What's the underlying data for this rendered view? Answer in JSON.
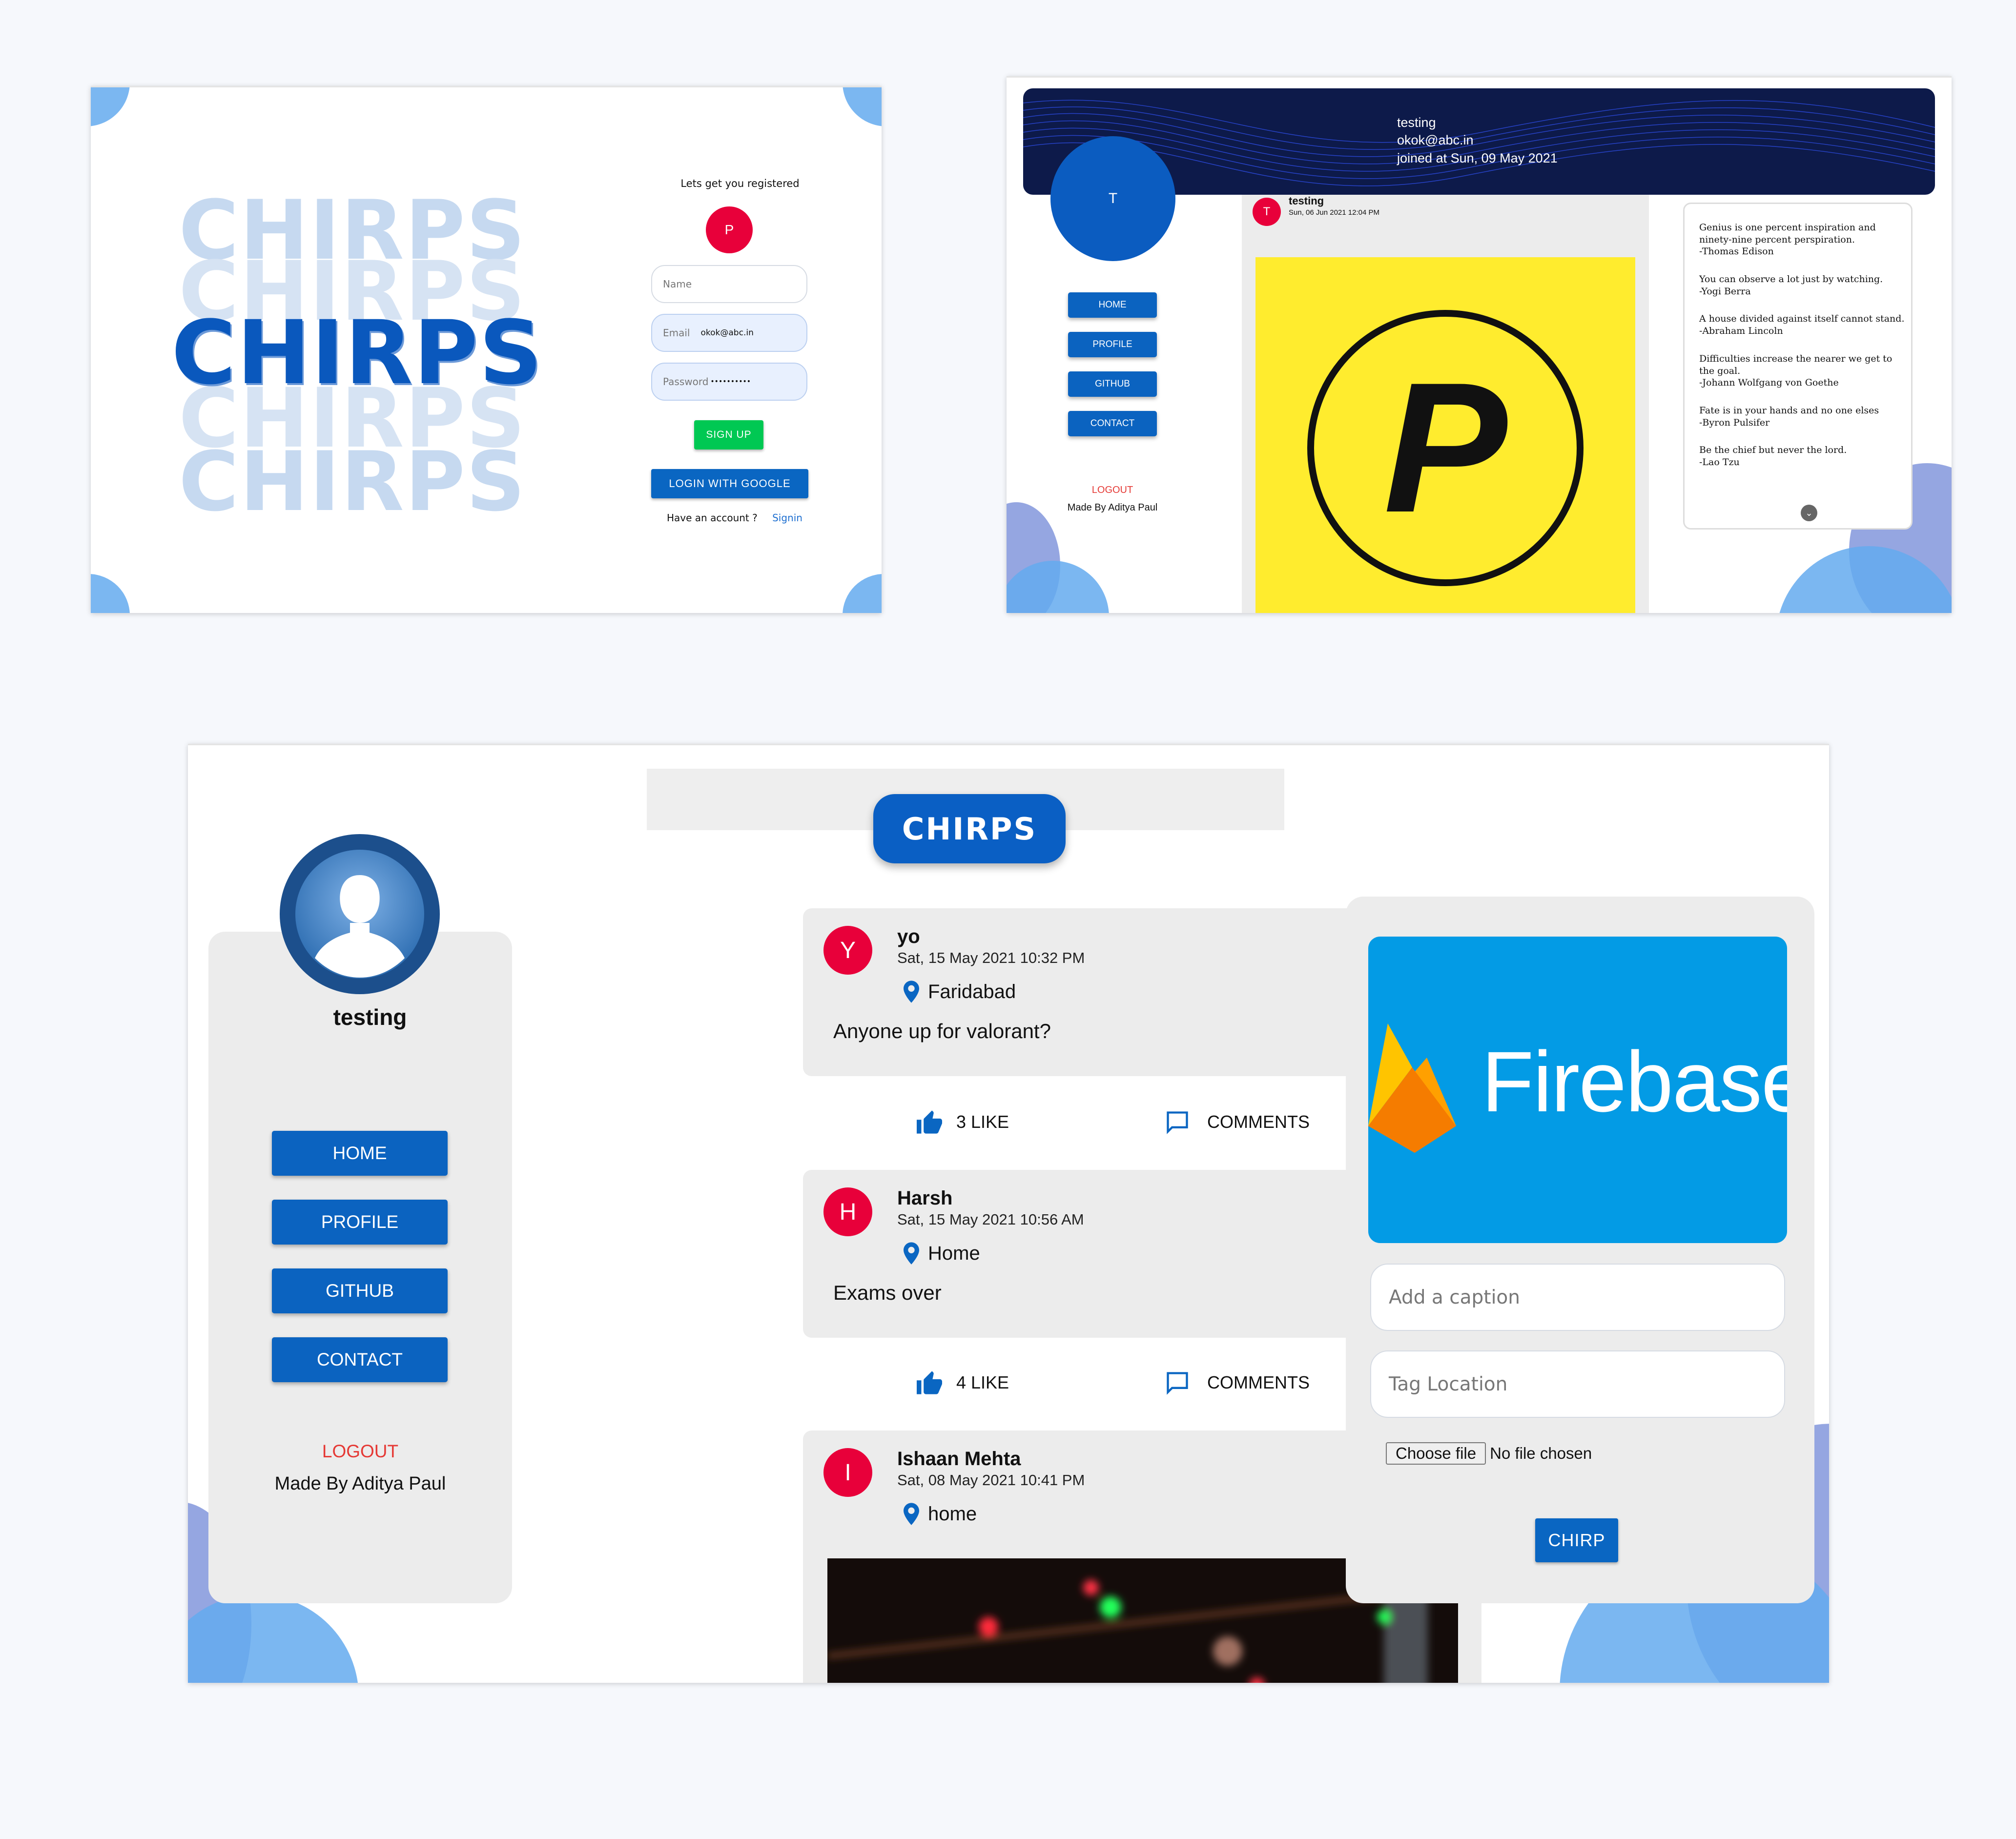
{
  "signup": {
    "brand_word": "CHIRPS",
    "heading": "Lets get you registered",
    "avatar_letter": "P",
    "name_placeholder": "Name",
    "email_label": "Email",
    "email_value": "okok@abc.in",
    "password_label": "Password",
    "password_value": "••••••••••",
    "signup_label": "SIGN UP",
    "google_label": "LOGIN WITH GOOGLE",
    "have_account": "Have an account ?",
    "signin_link": "Signin"
  },
  "profile": {
    "banner_name": "testing",
    "banner_email": "okok@abc.in",
    "banner_joined": "joined at Sun, 09 May 2021",
    "avatar_letter": "T",
    "nav": [
      "HOME",
      "PROFILE",
      "GITHUB",
      "CONTACT"
    ],
    "logout": "LOGOUT",
    "credit": "Made By Aditya Paul",
    "post": {
      "avatar": "T",
      "name": "testing",
      "date": "Sun, 06 Jun 2021 12:04 PM",
      "image_letter": "P"
    },
    "quotes": [
      {
        "text": "Genius is one percent inspiration and ninety-nine percent perspiration.",
        "author": "-Thomas Edison"
      },
      {
        "text": "You can observe a lot just by watching.",
        "author": "-Yogi Berra"
      },
      {
        "text": "A house divided against itself cannot stand.",
        "author": "-Abraham Lincoln"
      },
      {
        "text": "Difficulties increase the nearer we get to the goal.",
        "author": "-Johann Wolfgang von Goethe"
      },
      {
        "text": "Fate is in your hands and no one elses",
        "author": "-Byron Pulsifer"
      },
      {
        "text": "Be the chief but never the lord.",
        "author": "-Lao Tzu"
      }
    ]
  },
  "feed": {
    "logo": "CHIRPS",
    "username": "testing",
    "nav": [
      "HOME",
      "PROFILE",
      "GITHUB",
      "CONTACT"
    ],
    "logout": "LOGOUT",
    "credit": "Made By Aditya Paul",
    "posts": [
      {
        "avatar": "Y",
        "name": "yo",
        "date": "Sat, 15 May 2021 10:32 PM",
        "location": "Faridabad",
        "text": "Anyone up for valorant?",
        "likes": "3 LIKE",
        "comments": "COMMENTS"
      },
      {
        "avatar": "H",
        "name": "Harsh",
        "date": "Sat, 15 May 2021 10:56 AM",
        "location": "Home",
        "text": "Exams over",
        "likes": "4 LIKE",
        "comments": "COMMENTS"
      },
      {
        "avatar": "I",
        "name": "Ishaan Mehta",
        "date": "Sat, 08 May 2021 10:41 PM",
        "location": "home"
      }
    ],
    "composer": {
      "image_brand": "Firebase",
      "caption_placeholder": "Add a caption",
      "location_placeholder": "Tag Location",
      "file_button": "Choose file",
      "file_status": "No file chosen",
      "submit": "CHIRP"
    }
  },
  "colors": {
    "primary": "#0a66c2",
    "accent_red": "#e8003a",
    "google_green": "#00c853",
    "banner_navy": "#0d1a4a",
    "firebase_blue": "#039be5"
  }
}
